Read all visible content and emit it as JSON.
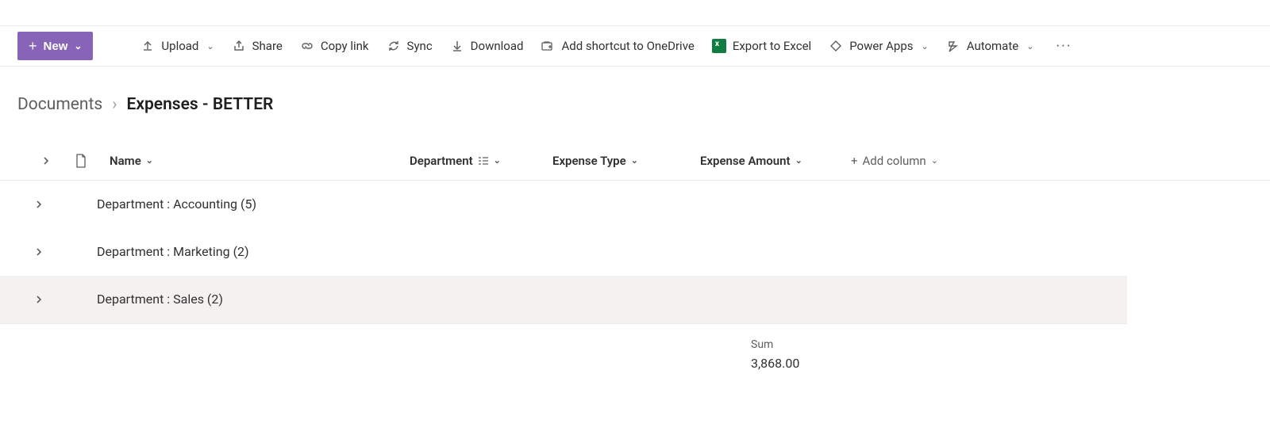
{
  "toolbar": {
    "new_label": "New",
    "upload": "Upload",
    "share": "Share",
    "copy_link": "Copy link",
    "sync": "Sync",
    "download": "Download",
    "add_shortcut": "Add shortcut to OneDrive",
    "export_excel": "Export to Excel",
    "power_apps": "Power Apps",
    "automate": "Automate"
  },
  "breadcrumbs": {
    "root": "Documents",
    "current": "Expenses - BETTER"
  },
  "columns": {
    "name": "Name",
    "department": "Department",
    "expense_type": "Expense Type",
    "expense_amount": "Expense Amount",
    "add_column": "Add column"
  },
  "groups": [
    {
      "label": "Department : Accounting (5)"
    },
    {
      "label": "Department : Marketing (2)"
    },
    {
      "label": "Department : Sales (2)"
    }
  ],
  "aggregate": {
    "label": "Sum",
    "value": "3,868.00"
  }
}
